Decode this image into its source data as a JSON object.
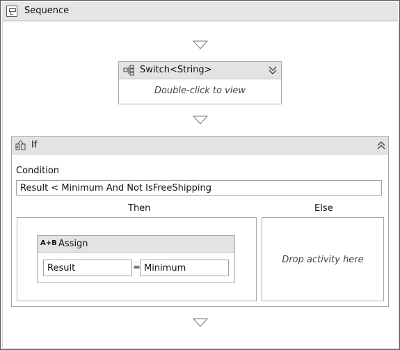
{
  "sequence": {
    "title": "Sequence",
    "icon": "sequence-icon"
  },
  "switch_activity": {
    "title": "Switch<String>",
    "hint": "Double-click to view",
    "icon": "switch-icon",
    "toggle_icon": "expand-chevron-icon"
  },
  "if_activity": {
    "title": "If",
    "icon": "if-icon",
    "toggle_icon": "collapse-chevron-icon",
    "condition_label": "Condition",
    "condition_value": "Result < Minimum And Not IsFreeShipping",
    "then_label": "Then",
    "else_label": "Else",
    "else_hint": "Drop activity here",
    "assign": {
      "title": "Assign",
      "icon_text": "A+B",
      "to_value": "Result",
      "equals": "=",
      "value": "Minimum"
    }
  }
}
